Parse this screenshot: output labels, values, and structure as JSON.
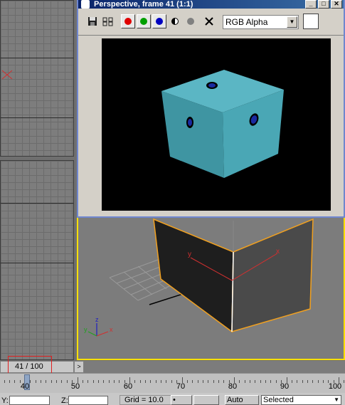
{
  "render_window": {
    "title": "Perspective, frame 41 (1:1)",
    "channel_select_value": "RGB Alpha"
  },
  "timeline": {
    "frame_counter": "41 / 100",
    "ruler_labels": [
      "40",
      "50",
      "60",
      "70",
      "80",
      "90",
      "100"
    ]
  },
  "statusbar": {
    "y_label": "Y:",
    "z_label": "Z:",
    "grid_text": "Grid = 10.0",
    "auto_key_label": "Auto Key",
    "selected_value": "Selected"
  },
  "viewport": {
    "axis_x": "x",
    "axis_y": "y",
    "axis_z": "z"
  },
  "colors": {
    "red_channel": "#e00000",
    "green_channel": "#009f00",
    "blue_channel": "#0000c0",
    "cube_top": "#5bb6c4",
    "cube_front": "#3f95a2",
    "cube_right": "#4aa7b5",
    "viewport_active_border": "#ffe000",
    "titlebar": "#0a246a"
  }
}
